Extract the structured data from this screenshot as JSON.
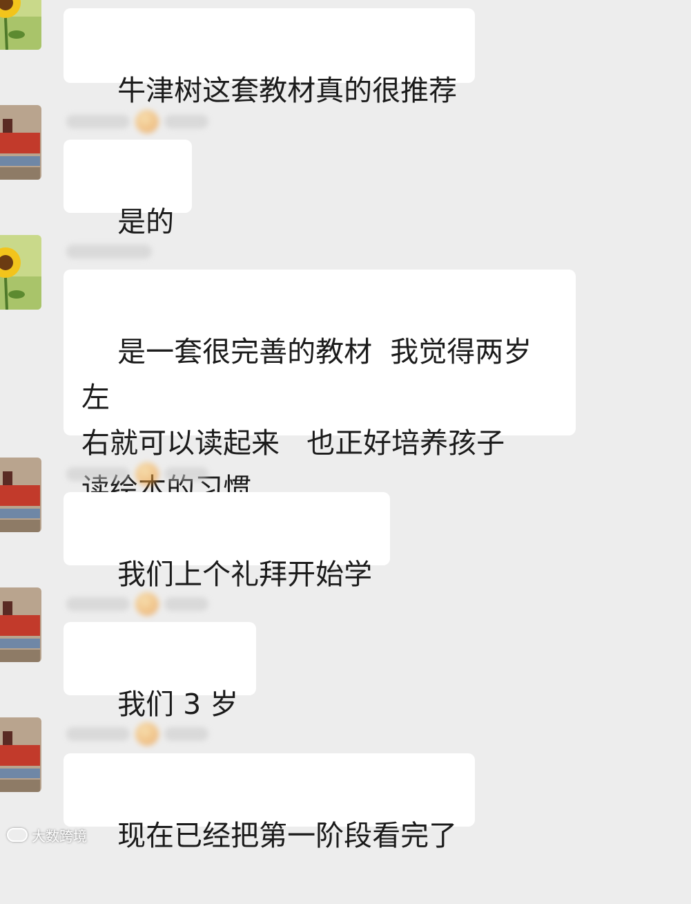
{
  "chat": {
    "messages": [
      {
        "avatar": "sunflower-avatar",
        "text": "牛津树这套教材真的很推荐"
      },
      {
        "avatar": "sign-avatar",
        "text": "是的"
      },
      {
        "avatar": "sunflower-avatar",
        "text": "是一套很完善的教材  我觉得两岁左\n右就可以读起来   也正好培养孩子\n读绘本的习惯"
      },
      {
        "avatar": "sign-avatar",
        "text": "我们上个礼拜开始学"
      },
      {
        "avatar": "sign-avatar",
        "text": "我们 3 岁"
      },
      {
        "avatar": "sign-avatar",
        "text": "现在已经把第一阶段看完了"
      }
    ]
  },
  "watermark": {
    "text": "大数跨境"
  },
  "colors": {
    "background": "#ededed",
    "bubble": "#ffffff",
    "text": "#1b1b1b"
  }
}
